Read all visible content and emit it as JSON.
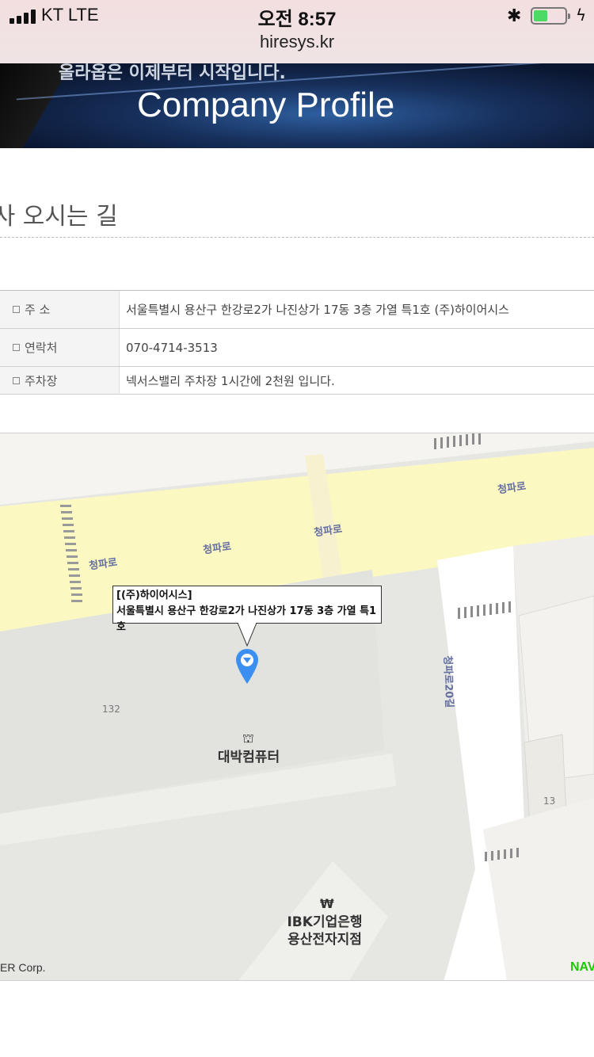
{
  "status_bar": {
    "carrier": "KT   LTE",
    "time": "오전 8:57",
    "url": "hiresys.kr",
    "battery_level": 0.45,
    "icons": [
      "signal-icon",
      "bluetooth-icon",
      "battery-icon",
      "charging-bolt-icon"
    ]
  },
  "banner": {
    "subtitle": "올라옵은 이제부터 시작입니다.",
    "title": "Company Profile"
  },
  "section": {
    "title": "회사 오시는 길"
  },
  "info_table": {
    "rows": [
      {
        "label": "주   소",
        "value": "서울특별시 용산구 한강로2가 나진상가 17동 3층 가열 특1호 (주)하이어시스"
      },
      {
        "label": "연락처",
        "value": "070-4714-3513"
      },
      {
        "label": "주차장",
        "value": "넥서스밸리 주차장 1시간에 2천원 입니다."
      }
    ]
  },
  "map": {
    "road_labels": [
      "청파로",
      "청파로",
      "청파로",
      "청파로",
      "청파로20길"
    ],
    "callout": {
      "company": "[(주)하이어시스]",
      "address": "서울특별시 용산구 한강로2가 나진상가 17동 3층 가열 특1호"
    },
    "pois": [
      {
        "name": "대박컴퓨터",
        "icon": "shopping-basket-icon"
      },
      {
        "name": "IBK기업은행\n용산전자지점",
        "icon": "won-icon"
      }
    ],
    "numbers": [
      "132",
      "13"
    ],
    "copyright": "ER Corp.",
    "logo": "NAV",
    "colors": {
      "road": "#fbf8c2",
      "pin": "#3b8ff0",
      "logo": "#1ec800"
    }
  }
}
